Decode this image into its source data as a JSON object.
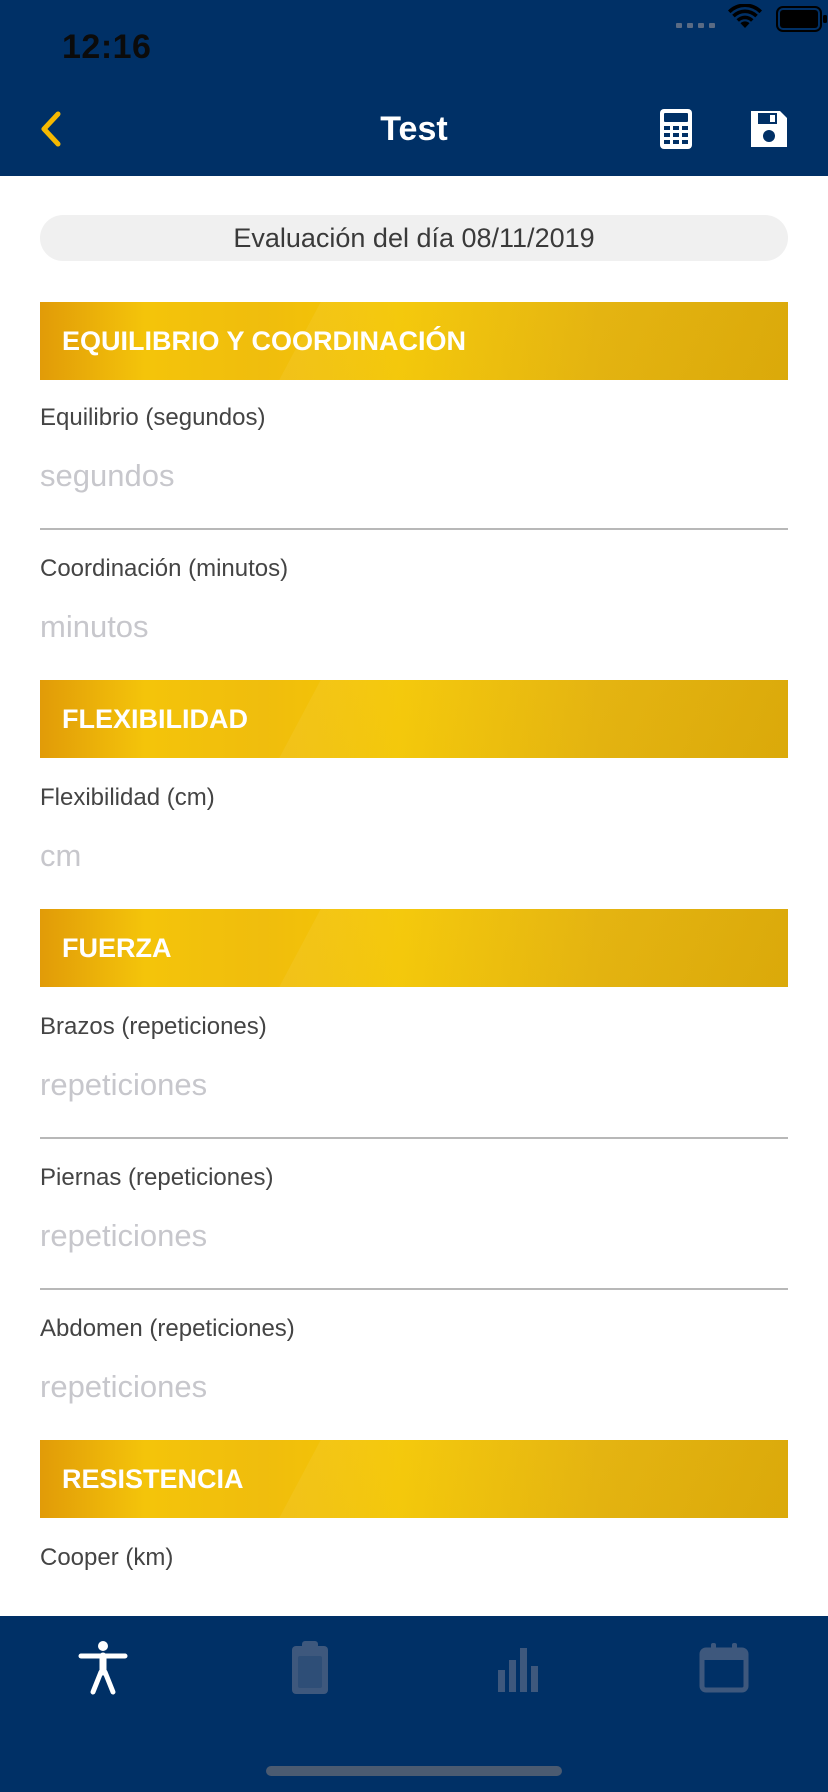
{
  "status_bar": {
    "time": "12:16"
  },
  "nav": {
    "title": "Test",
    "back_icon": "chevron-left-icon",
    "actions": [
      "calculator-icon",
      "save-floppy-icon"
    ]
  },
  "evaluation_date": "Evaluación del día 08/11/2019",
  "sections": {
    "s1": {
      "title": "EQUILIBRIO Y COORDINACIÓN",
      "fields": [
        {
          "label": "Equilibrio (segundos)",
          "placeholder": "segundos",
          "value": ""
        },
        {
          "label": "Coordinación (minutos)",
          "placeholder": "minutos",
          "value": ""
        }
      ]
    },
    "s2": {
      "title": "FLEXIBILIDAD",
      "fields": [
        {
          "label": "Flexibilidad (cm)",
          "placeholder": "cm",
          "value": ""
        }
      ]
    },
    "s3": {
      "title": "FUERZA",
      "fields": [
        {
          "label": "Brazos (repeticiones)",
          "placeholder": "repeticiones",
          "value": ""
        },
        {
          "label": "Piernas (repeticiones)",
          "placeholder": "repeticiones",
          "value": ""
        },
        {
          "label": "Abdomen (repeticiones)",
          "placeholder": "repeticiones",
          "value": ""
        }
      ]
    },
    "s4": {
      "title": "RESISTENCIA",
      "fields": [
        {
          "label": "Cooper (km)"
        }
      ]
    }
  },
  "tabbar": {
    "tabs": [
      {
        "icon": "person-accessibility-icon",
        "active": true
      },
      {
        "icon": "clipboard-icon",
        "active": false
      },
      {
        "icon": "bar-chart-icon",
        "active": false
      },
      {
        "icon": "calendar-icon",
        "active": false
      }
    ]
  },
  "colors": {
    "header_bg": "#003066",
    "accent_back": "#f5b800",
    "section_gradient": [
      "#e19b08",
      "#f6c800"
    ],
    "tab_active": "#ffffff",
    "tab_inactive": "#3e587d"
  }
}
